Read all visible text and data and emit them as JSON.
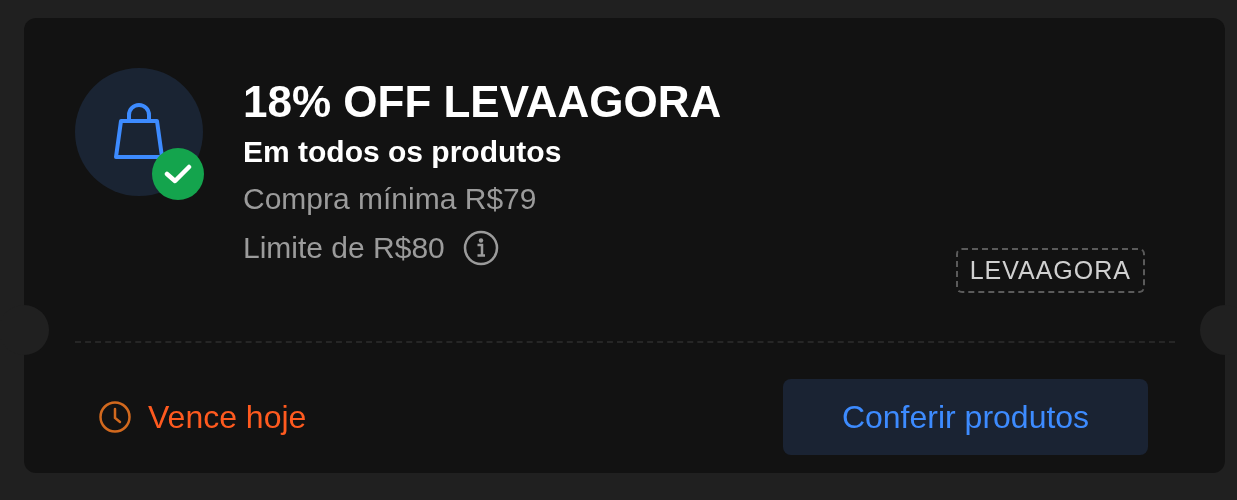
{
  "coupon": {
    "activated": true,
    "title": "18% OFF LEVAAGORA",
    "subtitle": "Em todos os produtos",
    "min_purchase": "Compra mínima R$79",
    "limit": "Limite de R$80",
    "code": "LEVAAGORA",
    "expiry": "Vence hoje",
    "action": "Conferir produtos"
  }
}
